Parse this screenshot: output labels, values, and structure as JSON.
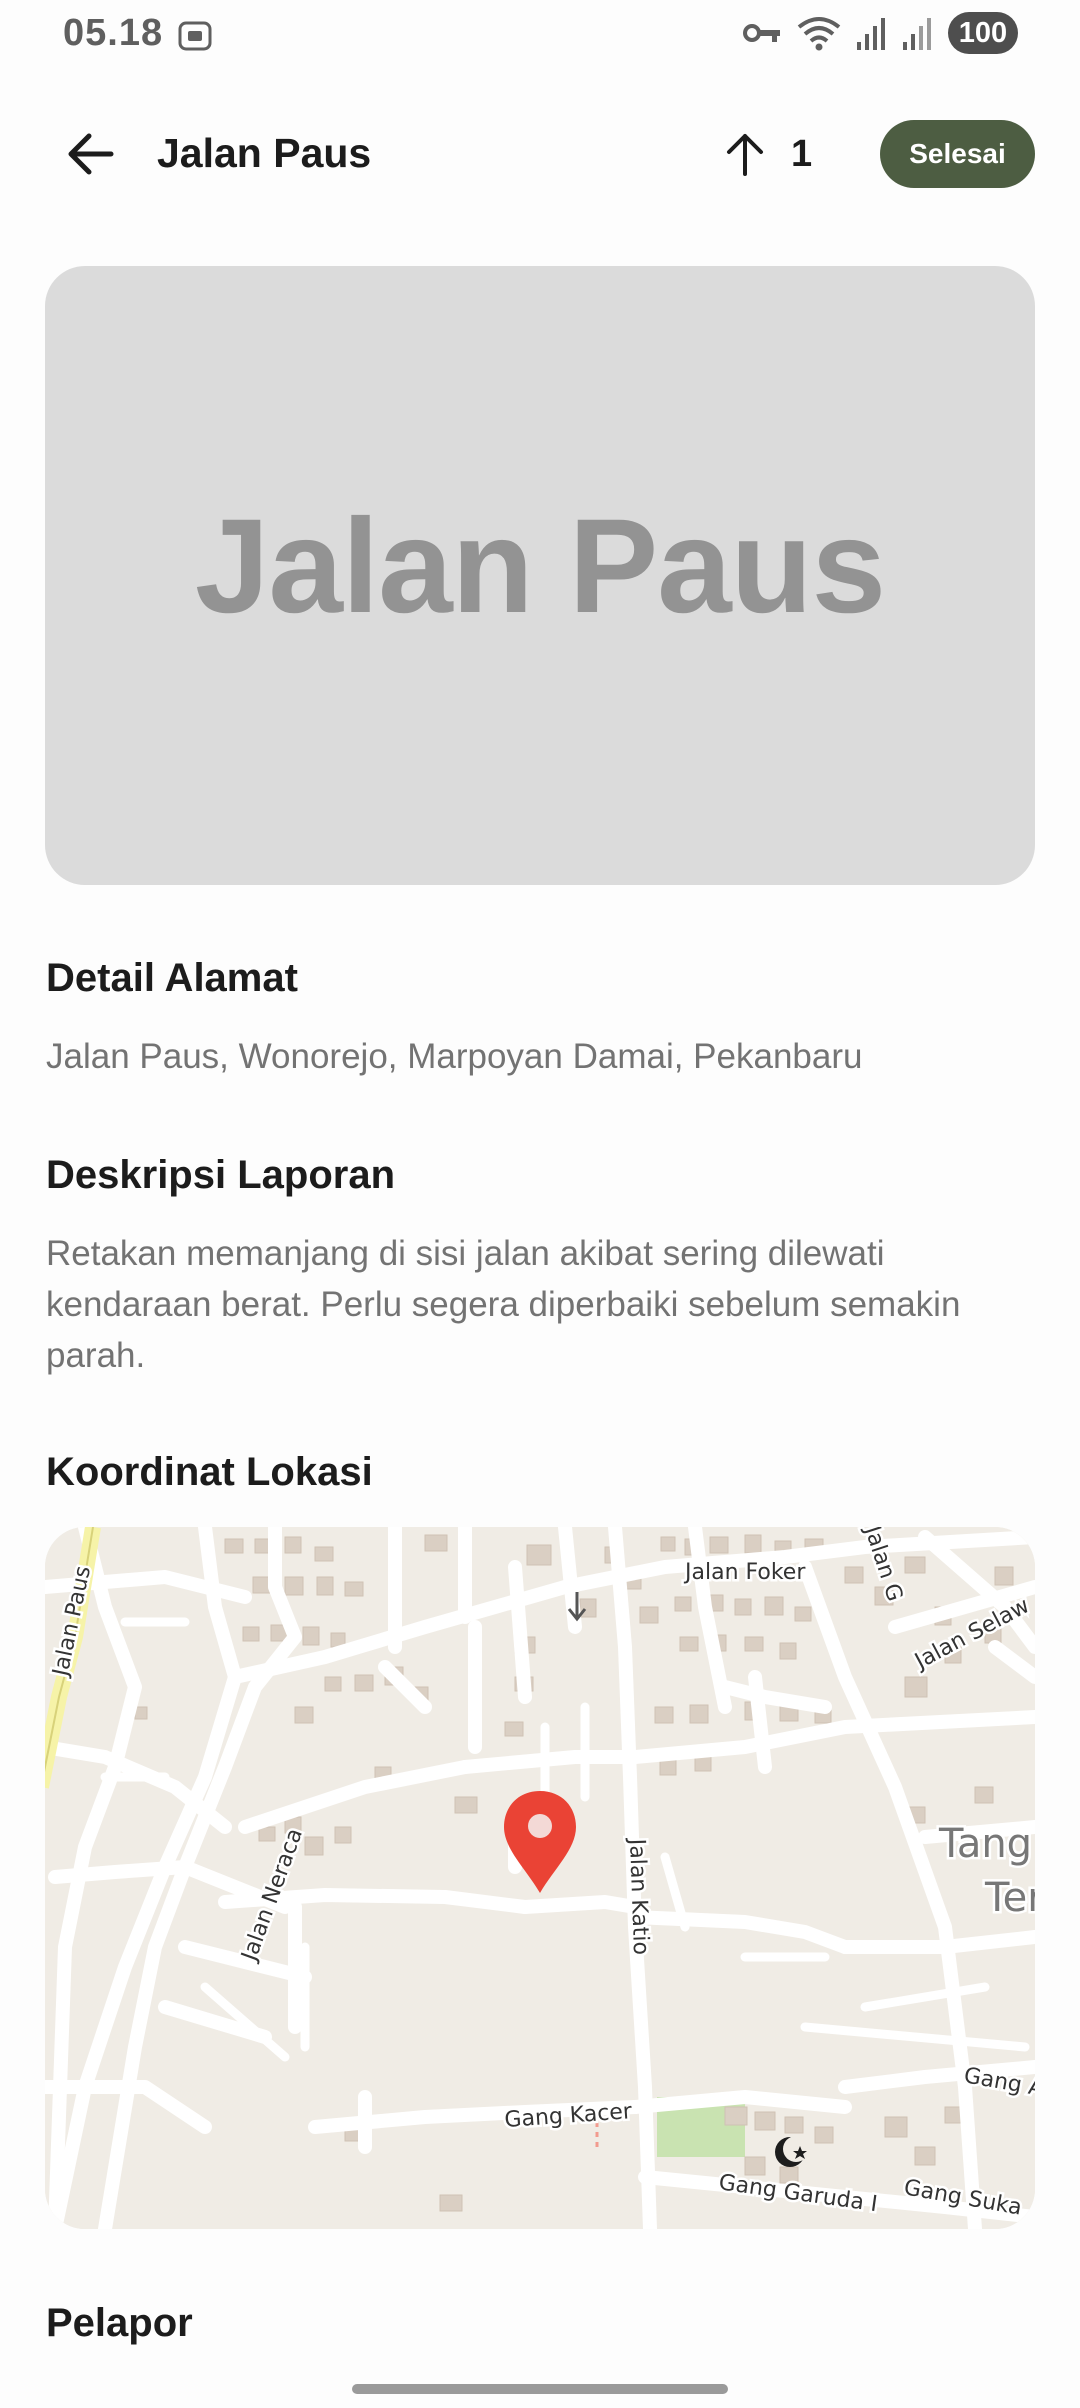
{
  "status_bar": {
    "time": "05.18",
    "battery": "100",
    "icons": [
      "screenshot-icon",
      "vpn-key-icon",
      "wifi-icon",
      "signal-icon",
      "signal-icon",
      "battery-icon"
    ]
  },
  "app_bar": {
    "title": "Jalan Paus",
    "upvote_count": "1",
    "done_label": "Selesai",
    "done_color": "#4d5d42"
  },
  "hero": {
    "placeholder_text": "Jalan Paus"
  },
  "address": {
    "title": "Detail Alamat",
    "text": "Jalan Paus, Wonorejo, Marpoyan Damai, Pekanbaru"
  },
  "description": {
    "title": "Deskripsi Laporan",
    "text": "Retakan memanjang di sisi jalan akibat sering dilewati kendaraan berat. Perlu segera diperbaiki sebelum semakin parah."
  },
  "location": {
    "title": "Koordinat Lokasi",
    "pin_color": "#ea4335",
    "map_labels": {
      "jalan_paus": "Jalan Paus",
      "jalan_foker": "Jalan Foker",
      "jalan_g": "Jalan G",
      "jalan_selaw": "Jalan Selaw",
      "jalan_neraca": "Jalan Neraca",
      "jalan_katio": "Jalan Katio",
      "tang": "Tang",
      "ter": "Ter",
      "gang_a": "Gang A",
      "gang_kacer": "Gang Kacer",
      "gang_garuda": "Gang Garuda I",
      "gang_suka": "Gang Suka"
    }
  },
  "reporter": {
    "title": "Pelapor"
  }
}
